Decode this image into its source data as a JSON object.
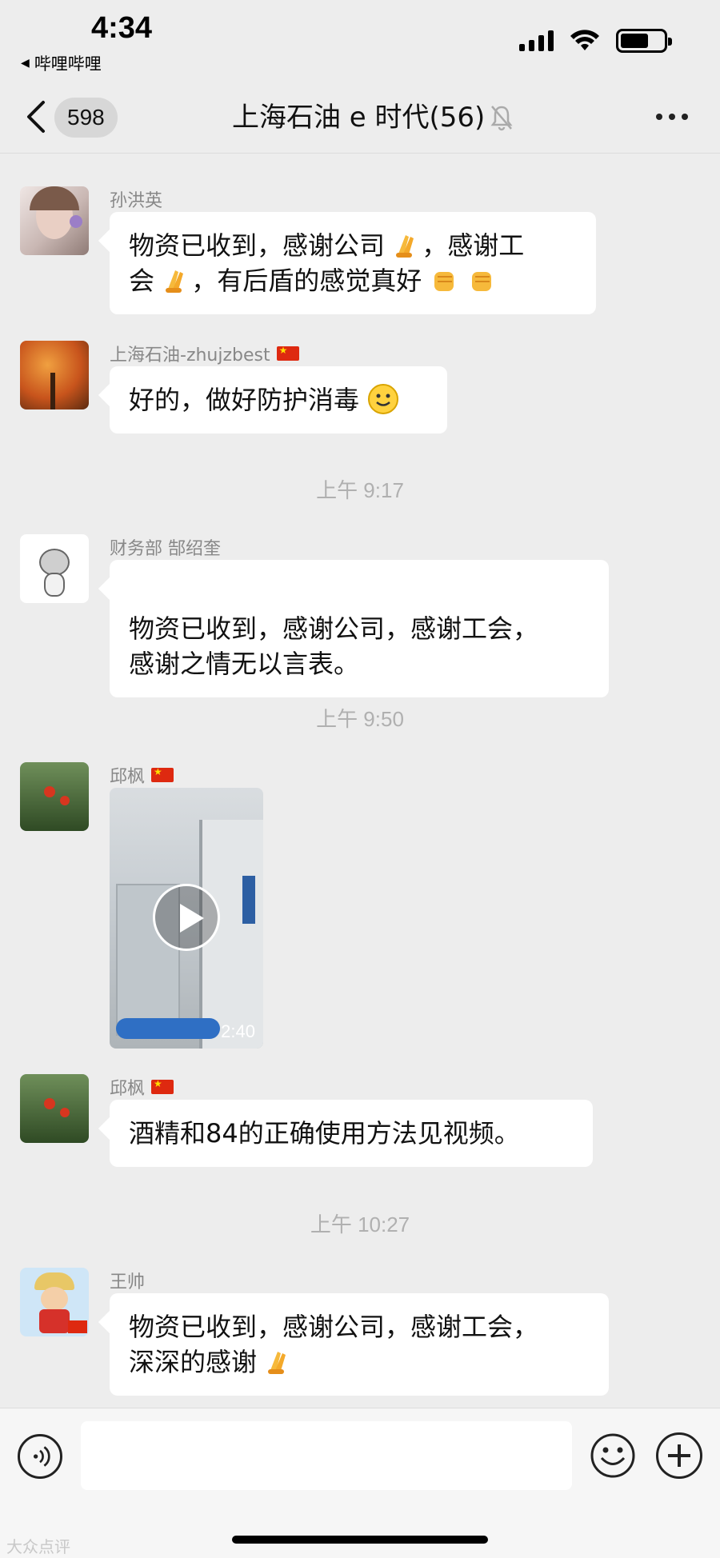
{
  "status_bar": {
    "time": "4:34",
    "back_app": "哔哩哔哩"
  },
  "nav": {
    "unread_count": "598",
    "title": "上海石油 e 时代(56)"
  },
  "messages": [
    {
      "sender": "孙洪英",
      "text_line1": "物资已收到，感谢公司",
      "text_line1b": "，感谢工",
      "text_line2": "会",
      "text_line2b": "，有后盾的感觉真好"
    },
    {
      "sender": "上海石油-zhujzbest",
      "text": "好的，做好防护消毒"
    },
    {
      "sender": "财务部 郜绍奎",
      "text": "物资已收到，感谢公司，感谢工会，\n感谢之情无以言表。"
    },
    {
      "sender": "邱枫",
      "video_duration": "2:40"
    },
    {
      "sender": "邱枫",
      "text": "酒精和84的正确使用方法见视频。"
    },
    {
      "sender": "王帅",
      "text_line1": "物资已收到，感谢公司，感谢工会，",
      "text_line2": "深深的感谢"
    }
  ],
  "timestamps": [
    "上午 9:17",
    "上午 9:50",
    "上午 10:27"
  ],
  "input": {
    "placeholder": ""
  },
  "watermark": "大众点评",
  "colors": {
    "background": "#ededed",
    "bubble": "#ffffff",
    "input_bar": "#f6f6f6"
  }
}
